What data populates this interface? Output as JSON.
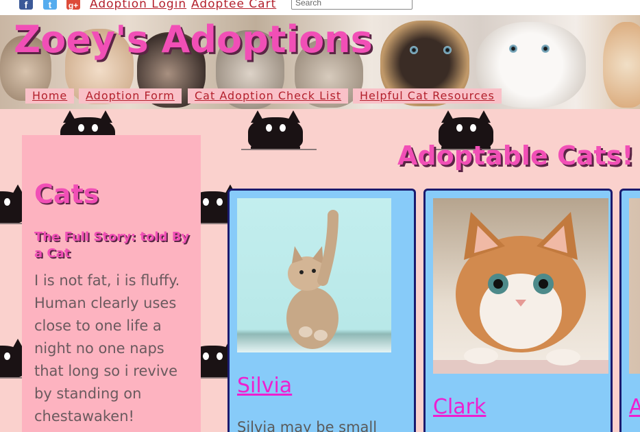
{
  "topbar": {
    "social": [
      {
        "icon": "facebook-icon",
        "glyph": "f"
      },
      {
        "icon": "twitter-icon",
        "glyph": "t"
      },
      {
        "icon": "google-plus-icon",
        "glyph": "g+"
      }
    ],
    "login_label": "Adoption Login",
    "cart_label": "Adoptee Cart",
    "search_placeholder": "Search"
  },
  "banner": {
    "title": "Zoey's Adoptions"
  },
  "nav": {
    "items": [
      {
        "label": "Home"
      },
      {
        "label": "Adoption Form"
      },
      {
        "label": "Cat Adoption Check List"
      },
      {
        "label": "Helpful Cat Resources"
      }
    ]
  },
  "sidebar": {
    "heading": "Cats",
    "subheading": "The Full Story: told By a Cat",
    "body": "I is not fat, i is fluffy. Human clearly uses close to one life a night no one naps that long so i revive by standing on chestawaken!"
  },
  "main": {
    "heading": "Adoptable Cats!",
    "cards": [
      {
        "name": "Silvia",
        "desc": "Silvia may be small"
      },
      {
        "name": "Clark",
        "desc": ""
      },
      {
        "name": "A",
        "desc": ""
      }
    ]
  },
  "colors": {
    "accent_pink": "#f14fb6",
    "link_red": "#b3202c",
    "card_blue": "#87cbf9",
    "page_bg": "#fad1cd",
    "sidebar_bg": "#fdb3c0"
  }
}
